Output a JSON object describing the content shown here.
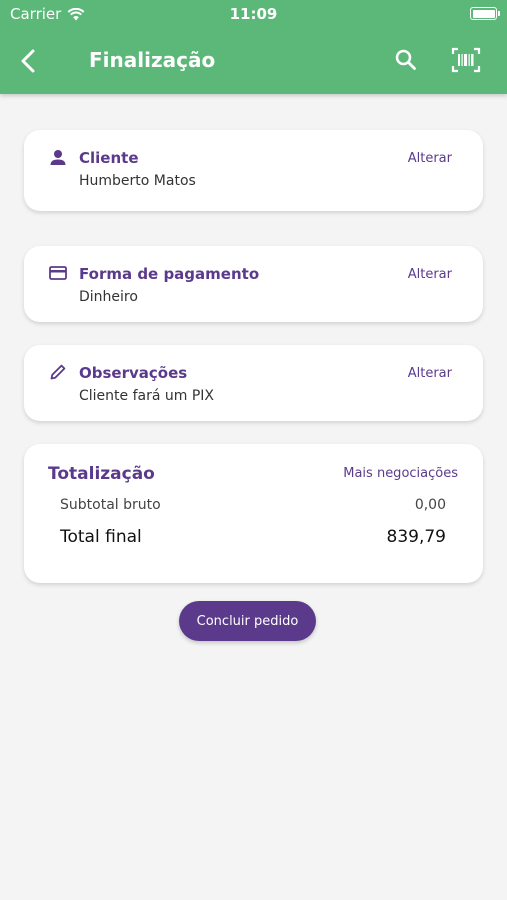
{
  "status_bar": {
    "carrier": "Carrier",
    "time": "11:09"
  },
  "header": {
    "title": "Finalização"
  },
  "cards": {
    "cliente": {
      "title": "Cliente",
      "value": "Humberto Matos",
      "action": "Alterar",
      "icon": "person-icon"
    },
    "pagamento": {
      "title": "Forma de pagamento",
      "value": "Dinheiro",
      "action": "Alterar",
      "icon": "credit-card-icon"
    },
    "observacoes": {
      "title": "Observações",
      "value": "Cliente fará um PIX",
      "action": "Alterar",
      "icon": "pencil-icon"
    }
  },
  "totalizacao": {
    "title": "Totalização",
    "action": "Mais negociações",
    "subtotal_label": "Subtotal bruto",
    "subtotal_value": "0,00",
    "total_label": "Total final",
    "total_value": "839,79"
  },
  "conclude_button": "Concluir pedido",
  "colors": {
    "header": "#5cb878",
    "accent": "#5b3a8c",
    "background": "#f4f4f4"
  }
}
